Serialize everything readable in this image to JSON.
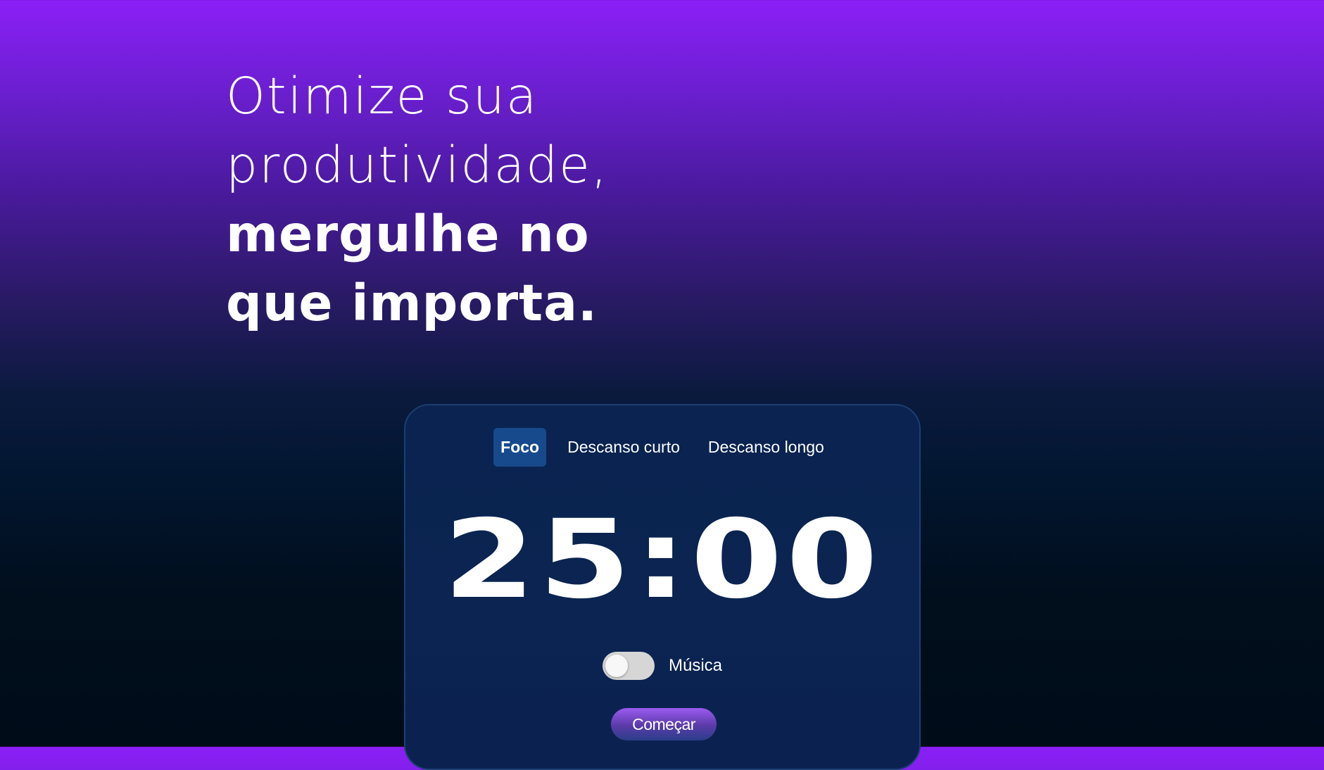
{
  "hero": {
    "line1": "Otimize sua",
    "line2": "produtividade,",
    "line3": "mergulhe no",
    "line4": "que importa."
  },
  "timer_card": {
    "tabs": [
      {
        "label": "Foco",
        "active": true
      },
      {
        "label": "Descanso curto",
        "active": false
      },
      {
        "label": "Descanso longo",
        "active": false
      }
    ],
    "time": "25:00",
    "music": {
      "label": "Música",
      "enabled": false
    },
    "start_label": "Começar"
  },
  "colors": {
    "gradient_top": "#8b1ff6",
    "gradient_bottom": "#000c18",
    "card_background": "#0a2350",
    "card_border": "#1b3f72",
    "active_tab": "#174a8c",
    "button_top": "#9b5cf0",
    "button_bottom": "#2a3f8a"
  }
}
